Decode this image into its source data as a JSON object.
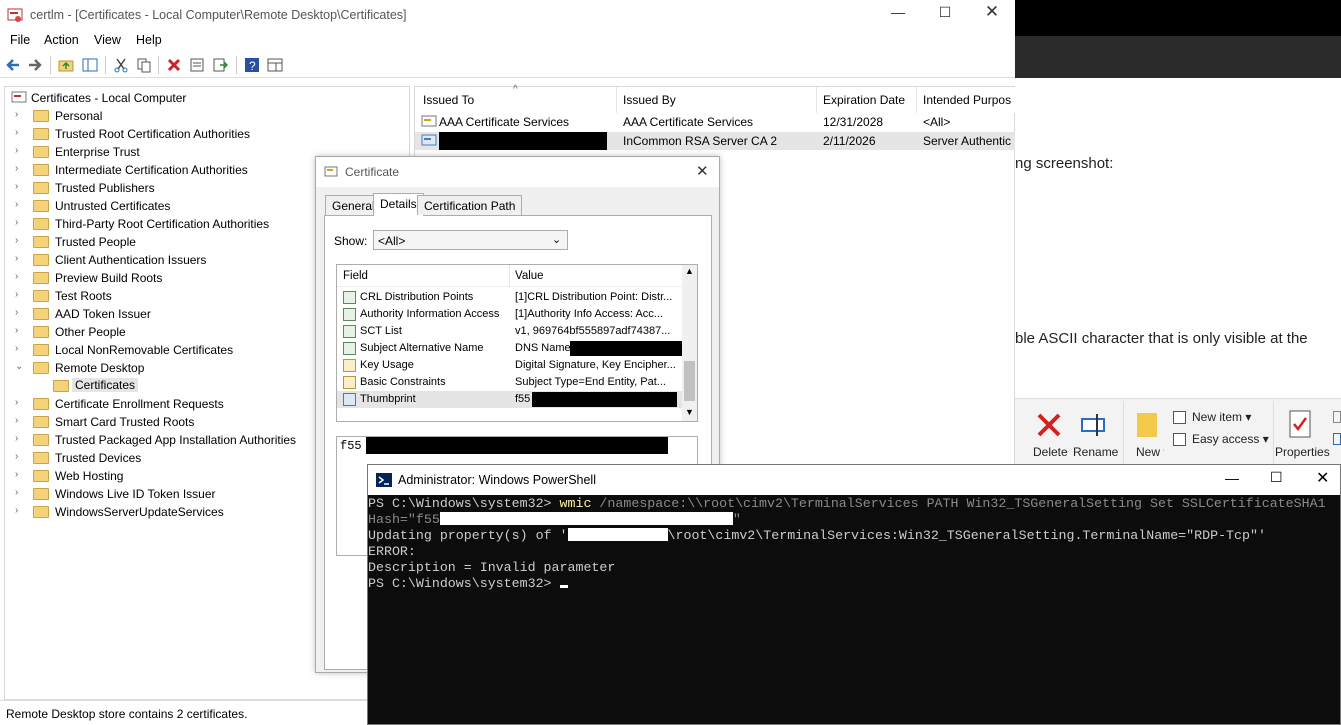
{
  "certlm": {
    "title": "certlm - [Certificates - Local Computer\\Remote Desktop\\Certificates]",
    "menu": [
      "File",
      "Action",
      "View",
      "Help"
    ],
    "tree": {
      "root": "Certificates - Local Computer",
      "items": [
        "Personal",
        "Trusted Root Certification Authorities",
        "Enterprise Trust",
        "Intermediate Certification Authorities",
        "Trusted Publishers",
        "Untrusted Certificates",
        "Third-Party Root Certification Authorities",
        "Trusted People",
        "Client Authentication Issuers",
        "Preview Build Roots",
        "Test Roots",
        "AAD Token Issuer",
        "Other People",
        "Local NonRemovable Certificates",
        "Remote Desktop",
        "Certificates",
        "Certificate Enrollment Requests",
        "Smart Card Trusted Roots",
        "Trusted Packaged App Installation Authorities",
        "Trusted Devices",
        "Web Hosting",
        "Windows Live ID Token Issuer",
        "WindowsServerUpdateServices"
      ]
    },
    "list": {
      "columns": [
        "Issued To",
        "Issued By",
        "Expiration Date",
        "Intended Purpos"
      ],
      "rows": [
        {
          "issued_to": "AAA Certificate Services",
          "issued_by": "AAA Certificate Services",
          "expires": "12/31/2028",
          "purpose": "<All>"
        },
        {
          "issued_to": "",
          "issued_by": "InCommon RSA Server CA 2",
          "expires": "2/11/2026",
          "purpose": "Server Authentic"
        }
      ]
    },
    "status": "Remote Desktop store contains 2 certificates."
  },
  "background": {
    "line1": "ng screenshot:",
    "line2": "ble ASCII character that is only visible at the",
    "ribbon": {
      "delete": "Delete",
      "rename": "Rename",
      "new_folder": "New folder",
      "new_item": "New item",
      "easy_access": "Easy access",
      "properties": "Properties"
    }
  },
  "dialog": {
    "title": "Certificate",
    "tabs": [
      "General",
      "Details",
      "Certification Path"
    ],
    "show_label": "Show:",
    "show_value": "<All>",
    "grid_headers": [
      "Field",
      "Value"
    ],
    "fields": [
      {
        "field": "CRL Distribution Points",
        "value": "[1]CRL Distribution Point: Distr..."
      },
      {
        "field": "Authority Information Access",
        "value": "[1]Authority Info Access: Acc..."
      },
      {
        "field": "SCT List",
        "value": "v1, 969764bf555897adf74387..."
      },
      {
        "field": "Subject Alternative Name",
        "value": "DNS Name="
      },
      {
        "field": "Key Usage",
        "value": "Digital Signature, Key Encipher..."
      },
      {
        "field": "Basic Constraints",
        "value": "Subject Type=End Entity, Pat..."
      },
      {
        "field": "Thumbprint",
        "value": "f55"
      }
    ],
    "value_box": "f55"
  },
  "powershell": {
    "title": "Administrator: Windows PowerShell",
    "prompt": "PS C:\\Windows\\system32> ",
    "cmd": "wmic",
    "args": " /namespace:\\\\root\\cimv2\\TerminalServices PATH Win32_TSGeneralSetting Set SSLCertificateSHA1",
    "line2a": "Hash=\"f55",
    "line2b": "\"",
    "line3a": "Updating property(s) of '",
    "line3b": "\\root\\cimv2\\TerminalServices:Win32_TSGeneralSetting.TerminalName=\"RDP-Tcp\"'",
    "line4": "ERROR:",
    "line5": "Description = Invalid parameter",
    "line6": "PS C:\\Windows\\system32> "
  }
}
